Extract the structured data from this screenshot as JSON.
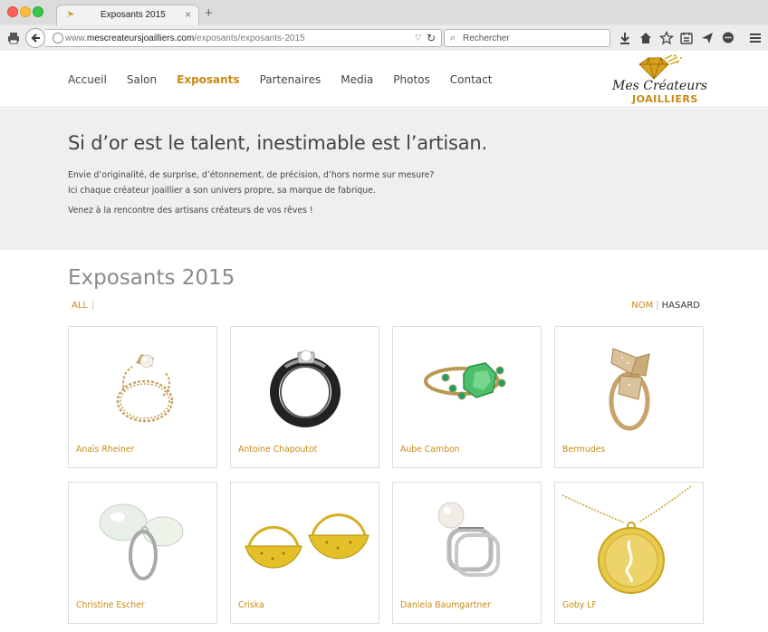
{
  "browser": {
    "tab_title": "Exposants 2015",
    "tab_close": "×",
    "new_tab": "+",
    "url_prefix": "www.",
    "url_domain": "mescreateursjoailliers.com",
    "url_path": "/exposants/exposants-2015",
    "search_placeholder": "Rechercher"
  },
  "nav": {
    "items": [
      "Accueil",
      "Salon",
      "Exposants",
      "Partenaires",
      "Media",
      "Photos",
      "Contact"
    ],
    "active": "Exposants"
  },
  "logo": {
    "script": "Mes Créateurs",
    "sub": "JOAILLIERS"
  },
  "hero": {
    "title": "Si d’or est le talent, inestimable est l’artisan.",
    "line1": "Envie d’originalité, de surprise, d’étonnement, de précision, d’hors norme sur mesure?",
    "line2": "Ici chaque créateur joaillier a son univers propre, sa marque de fabrique.",
    "line3": "Venez à la rencontre des artisans créateurs de vos rêves !"
  },
  "section": {
    "title": "Exposants 2015",
    "filter_all": "ALL",
    "sort_nom": "NOM",
    "sort_hasard": "HASARD"
  },
  "exhibitors": [
    {
      "name": "Anaïs Rheiner",
      "icon": "pearl-chain-ring-icon"
    },
    {
      "name": "Antoine Chapoutot",
      "icon": "black-ring-icon"
    },
    {
      "name": "Aube Cambon",
      "icon": "emerald-ring-icon"
    },
    {
      "name": "Bermudes",
      "icon": "bow-ring-icon"
    },
    {
      "name": "Christine Escher",
      "icon": "pearl-baroque-ring-icon"
    },
    {
      "name": "Criska",
      "icon": "gold-hoop-earrings-icon"
    },
    {
      "name": "Daniela Baumgartner",
      "icon": "pearl-stack-ring-icon"
    },
    {
      "name": "Goby LF",
      "icon": "gold-medallion-pendant-icon"
    }
  ],
  "colors": {
    "accent": "#c98a14",
    "hero_bg": "#efefef",
    "card_border": "#dcdcdc"
  }
}
